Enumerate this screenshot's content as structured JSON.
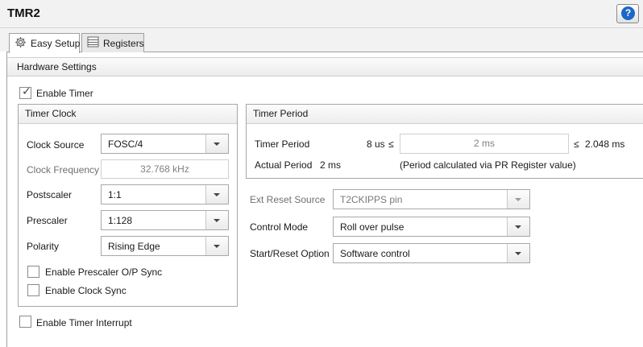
{
  "window": {
    "title": "TMR2",
    "help_icon": "?"
  },
  "tabs": [
    {
      "label": "Easy Setup",
      "icon": "gear-icon"
    },
    {
      "label": "Registers",
      "icon": "register-table-icon"
    }
  ],
  "hardware_settings": {
    "header": "Hardware Settings",
    "enable_timer": {
      "label": "Enable Timer",
      "checked": true
    },
    "enable_timer_interrupt": {
      "label": "Enable Timer Interrupt",
      "checked": false
    }
  },
  "timer_clock": {
    "title": "Timer Clock",
    "clock_source": {
      "label": "Clock Source",
      "value": "FOSC/4"
    },
    "clock_frequency": {
      "label": "Clock Frequency",
      "value": "32.768 kHz"
    },
    "postscaler": {
      "label": "Postscaler",
      "value": "1:1"
    },
    "prescaler": {
      "label": "Prescaler",
      "value": "1:128"
    },
    "polarity": {
      "label": "Polarity",
      "value": "Rising Edge"
    },
    "prescaler_sync": {
      "label": "Enable Prescaler O/P Sync",
      "checked": false
    },
    "clock_sync": {
      "label": "Enable Clock Sync",
      "checked": false
    }
  },
  "timer_period": {
    "title": "Timer Period",
    "period_label": "Timer Period",
    "min_text": "8 us",
    "le1": "≤",
    "value": "2 ms",
    "le2": "≤",
    "max_text": "2.048 ms",
    "actual_label": "Actual Period",
    "actual_value": "2 ms",
    "note": "(Period calculated via PR Register value)"
  },
  "ext_reset_source": {
    "label": "Ext Reset Source",
    "value": "T2CKIPPS pin"
  },
  "control_mode": {
    "label": "Control Mode",
    "value": "Roll over pulse"
  },
  "start_reset_option": {
    "label": "Start/Reset Option",
    "value": "Software control"
  }
}
